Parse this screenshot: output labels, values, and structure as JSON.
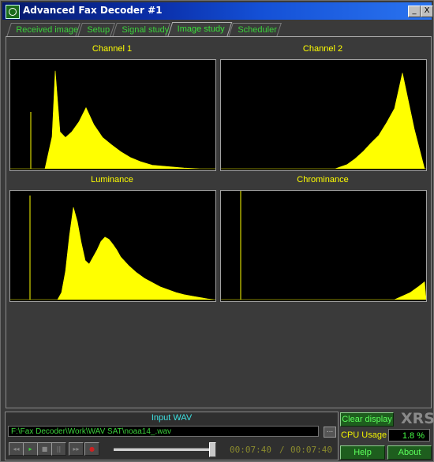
{
  "window": {
    "title": "Advanced Fax Decoder #1",
    "minimize_glyph": "_",
    "close_glyph": "X"
  },
  "tabs": [
    {
      "label": "Received image",
      "active": false
    },
    {
      "label": "Setup",
      "active": false
    },
    {
      "label": "Signal study",
      "active": false
    },
    {
      "label": "Image study",
      "active": true
    },
    {
      "label": "Scheduler",
      "active": false
    }
  ],
  "plots": {
    "channel1": {
      "title": "Channel 1"
    },
    "channel2": {
      "title": "Channel 2"
    },
    "luminance": {
      "title": "Luminance"
    },
    "chrominance": {
      "title": "Chrominance"
    }
  },
  "chart_data": [
    {
      "type": "area",
      "title": "Channel 1",
      "x": [
        0,
        4,
        9,
        13,
        16,
        19,
        21,
        23,
        27,
        31,
        35,
        39,
        44,
        49,
        53,
        57,
        63,
        70,
        78,
        87,
        96,
        106,
        117,
        128,
        140,
        152,
        165,
        180,
        200,
        220,
        240,
        258
      ],
      "values": [
        0,
        0,
        0,
        0,
        0,
        0,
        0,
        0,
        0,
        0,
        0,
        0,
        0,
        25,
        45,
        138,
        52,
        44,
        52,
        66,
        86,
        62,
        44,
        34,
        24,
        16,
        10,
        5,
        3,
        1,
        0,
        0
      ]
    },
    {
      "type": "area",
      "title": "Channel 2",
      "x": [
        0,
        20,
        40,
        60,
        80,
        90,
        95,
        100,
        105,
        110,
        115,
        120,
        122,
        124,
        126,
        128,
        130,
        132,
        135,
        140,
        145,
        150,
        160,
        170,
        180,
        190,
        200,
        210,
        220,
        230,
        245,
        258
      ],
      "values": [
        0,
        0,
        0,
        0,
        0,
        0,
        0,
        0,
        0,
        0,
        0,
        0,
        0,
        0,
        0,
        0,
        0,
        0,
        0,
        0,
        0,
        2,
        6,
        14,
        24,
        36,
        47,
        65,
        85,
        135,
        56,
        0
      ]
    },
    {
      "type": "area",
      "title": "Luminance",
      "x": [
        0,
        5,
        10,
        15,
        20,
        25,
        28,
        30,
        35,
        40,
        45,
        50,
        55,
        60,
        65,
        70,
        75,
        80,
        85,
        90,
        95,
        100,
        105,
        110,
        115,
        120,
        125,
        130,
        135,
        140,
        150,
        160,
        170,
        180,
        190,
        200,
        210,
        220,
        230,
        240,
        250,
        258
      ],
      "values": [
        0,
        0,
        0,
        0,
        0,
        0,
        0,
        0,
        0,
        0,
        0,
        0,
        0,
        0,
        10,
        40,
        90,
        130,
        110,
        80,
        55,
        50,
        60,
        70,
        82,
        88,
        85,
        78,
        70,
        60,
        48,
        38,
        30,
        24,
        18,
        14,
        10,
        7,
        5,
        3,
        1,
        0
      ]
    },
    {
      "type": "area",
      "title": "Chrominance",
      "x": [
        0,
        20,
        40,
        60,
        80,
        100,
        120,
        140,
        160,
        180,
        200,
        220,
        240,
        250,
        258
      ],
      "values": [
        0,
        0,
        0,
        0,
        0,
        0,
        0,
        0,
        0,
        0,
        0,
        0,
        10,
        18,
        25
      ]
    }
  ],
  "input": {
    "label": "Input WAV",
    "path": "F:\\Fax Decoder\\Work\\WAV SAT\\noaa14_.wav",
    "browse": "...",
    "time_elapsed": "00:07:40",
    "time_separator": "/",
    "time_total": "00:07:40",
    "progress": 1.0
  },
  "controls": {
    "rewind": "◂◂",
    "play": "▸",
    "stop": "■",
    "pause": "||",
    "forward": "▸▸",
    "record": "●"
  },
  "side": {
    "clear_display": "Clear display",
    "brand": "XRS",
    "cpu_label": "CPU Usage",
    "cpu_value": "1.8 %",
    "help": "Help",
    "about": "About"
  },
  "colors": {
    "histogram": "#ffff00",
    "accent_green": "#3bd23b",
    "input_label": "#3ee0e0"
  }
}
